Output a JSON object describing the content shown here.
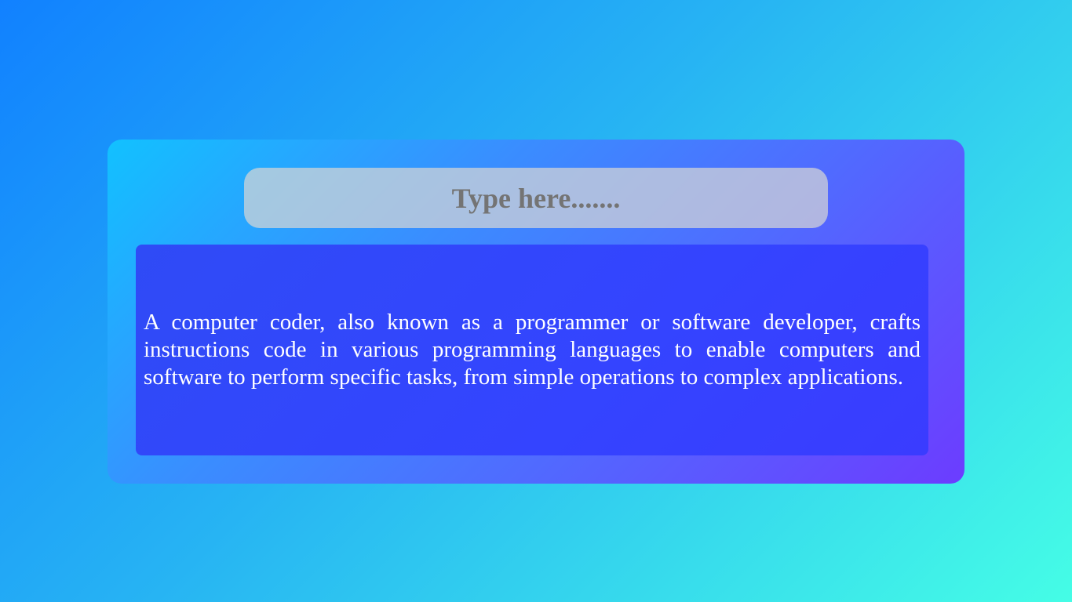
{
  "search": {
    "placeholder": "Type here......."
  },
  "content": {
    "paragraph": "A computer coder, also known as a programmer or software developer, crafts instructions code in various programming languages to enable computers and software to perform specific tasks, from simple operations to complex applications."
  },
  "colors": {
    "background_start": "#1181ff",
    "background_end": "#45fde6",
    "card_start": "#12c1ff",
    "card_end": "#6c3cff",
    "panel": "#3444ff",
    "text": "#ffffff",
    "placeholder": "#747474"
  }
}
